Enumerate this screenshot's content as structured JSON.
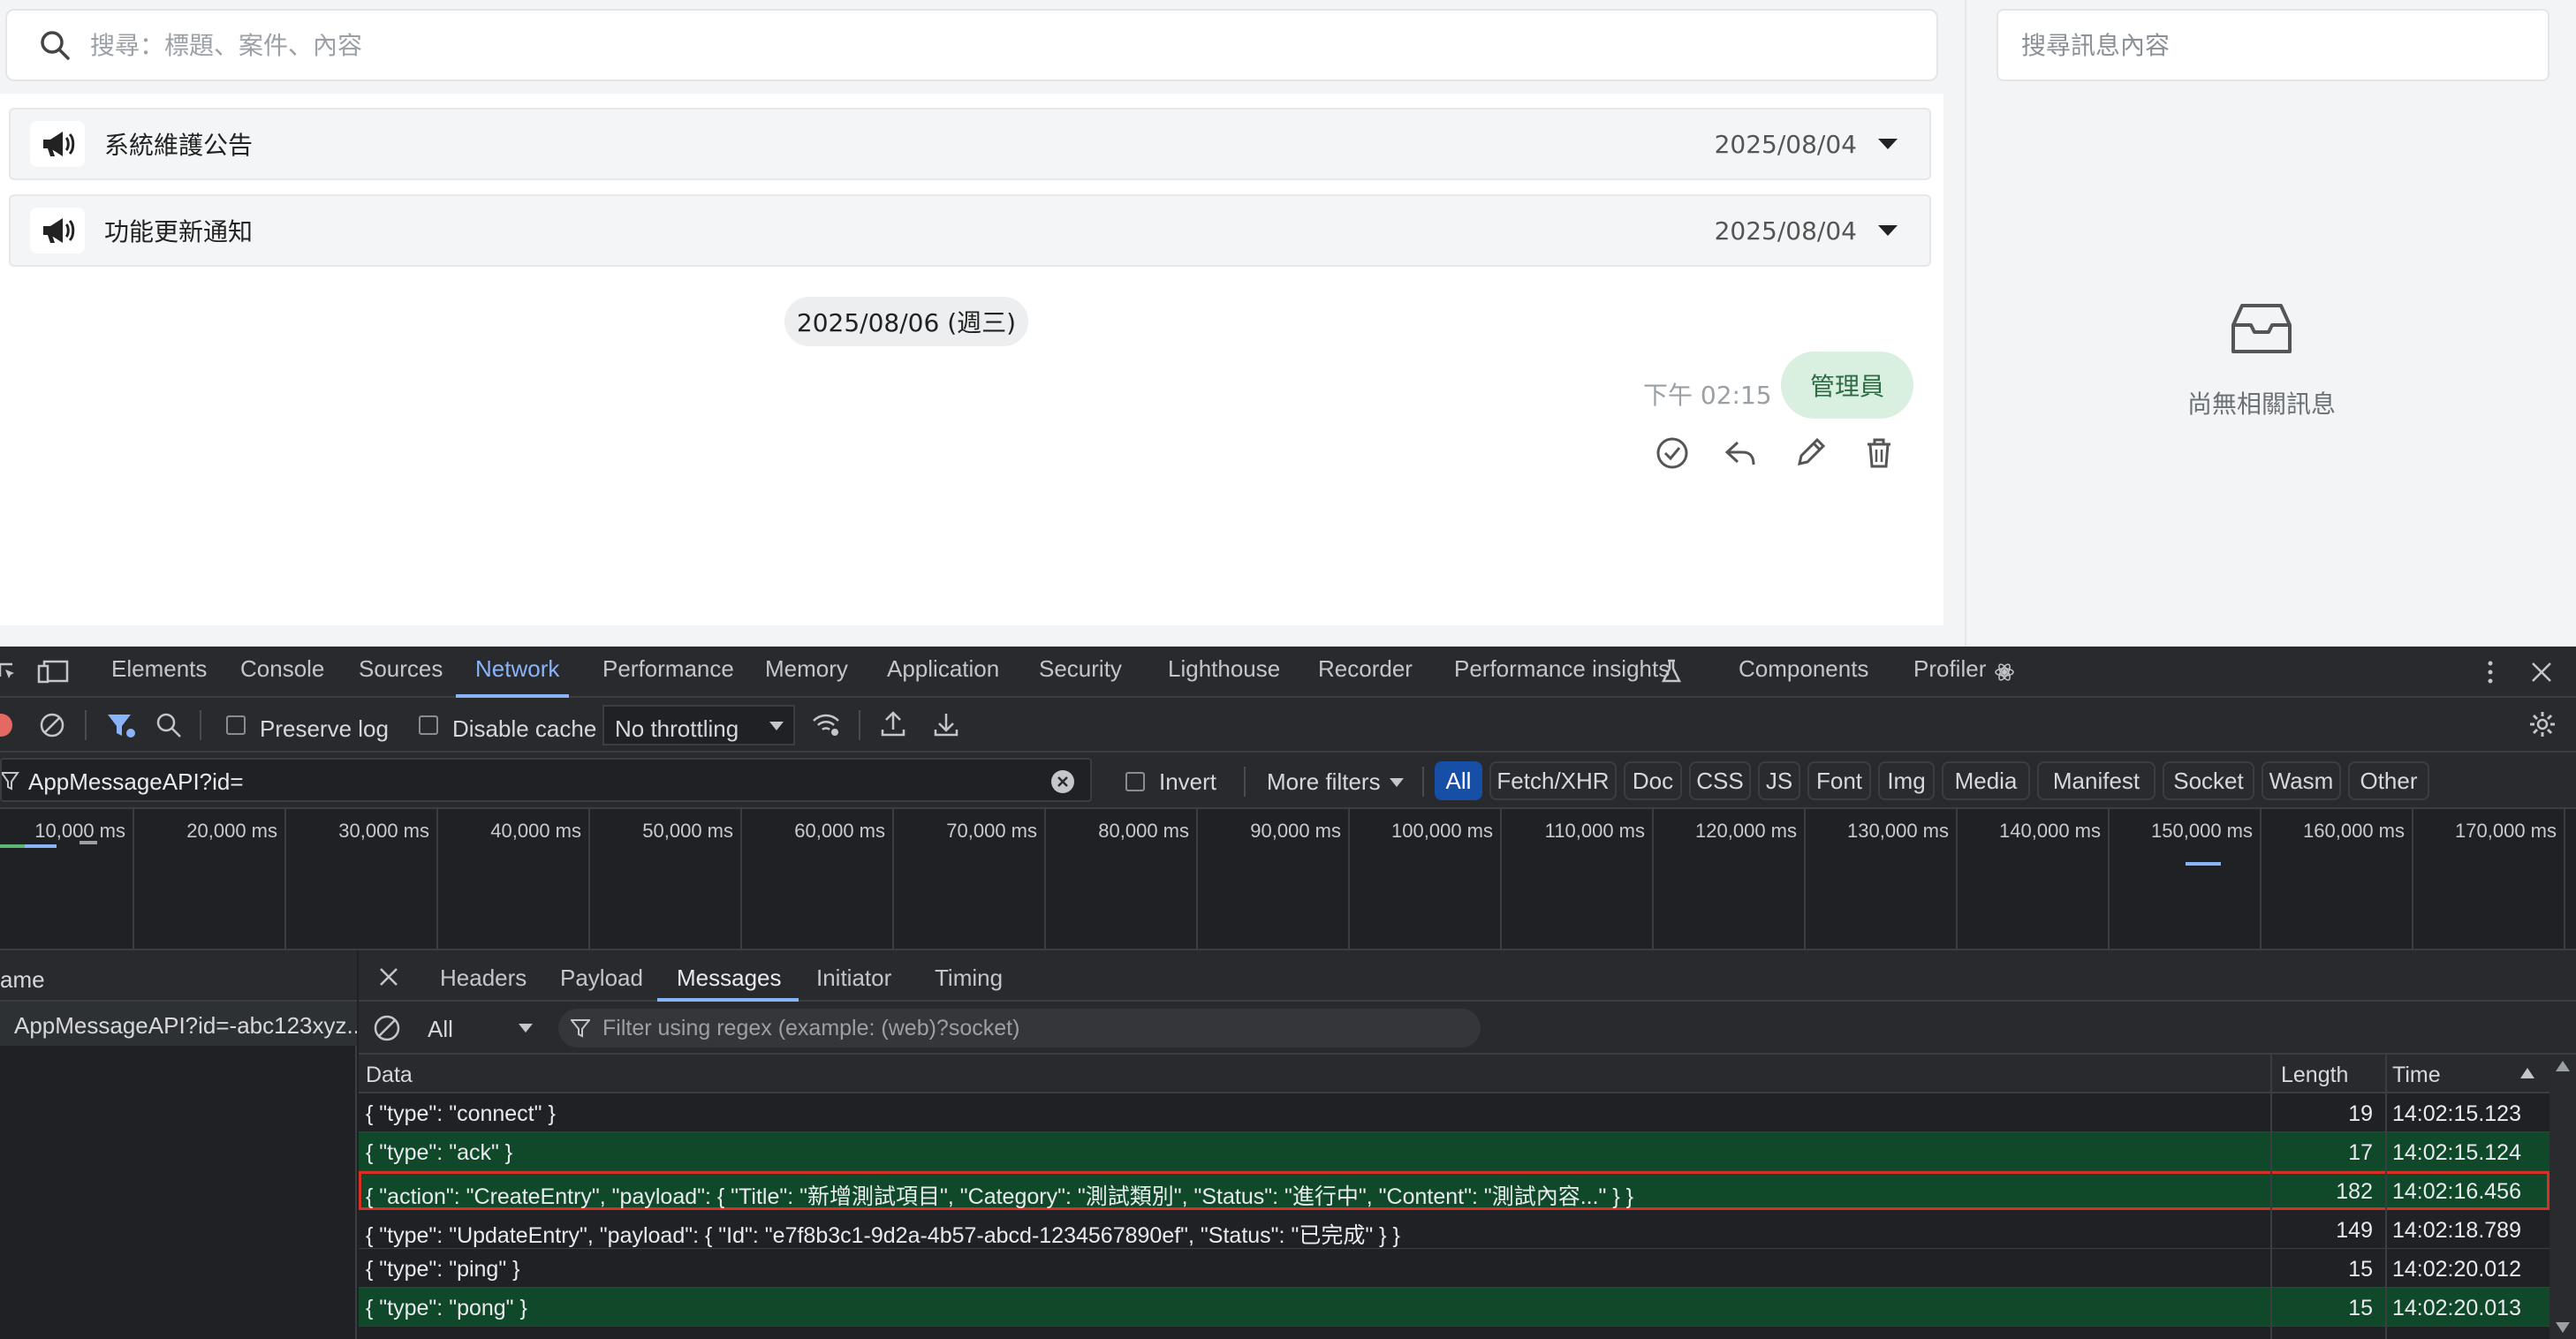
{
  "app": {
    "search_placeholder": "搜尋：標題、案件、內容",
    "announcements": [
      {
        "title": "系統維護公告",
        "date": "2025/08/04"
      },
      {
        "title": "功能更新通知",
        "date": "2025/08/04"
      }
    ],
    "date_divider": "2025/08/06 (週三)",
    "message": {
      "time": "下午 02:15",
      "sender": "管理員"
    },
    "message_actions": [
      "check-circle-icon",
      "reply-icon",
      "edit-icon",
      "trash-icon"
    ],
    "right_panel": {
      "search_placeholder": "搜尋訊息內容",
      "empty_text": "尚無相關訊息"
    }
  },
  "devtools": {
    "tabs": [
      "Elements",
      "Console",
      "Sources",
      "Network",
      "Performance",
      "Memory",
      "Application",
      "Security",
      "Lighthouse",
      "Recorder",
      "Performance insights",
      "Components",
      "Profiler"
    ],
    "active_tab": "Network",
    "toolbar": {
      "preserve_log": "Preserve log",
      "disable_cache": "Disable cache",
      "throttling": "No throttling"
    },
    "filter": {
      "value": "AppMessageAPI?id=",
      "invert": "Invert",
      "more_filters": "More filters",
      "types": [
        "All",
        "Fetch/XHR",
        "Doc",
        "CSS",
        "JS",
        "Font",
        "Img",
        "Media",
        "Manifest",
        "Socket",
        "Wasm",
        "Other"
      ],
      "active_type": "All"
    },
    "timeline_ticks": [
      "10,000 ms",
      "20,000 ms",
      "30,000 ms",
      "40,000 ms",
      "50,000 ms",
      "60,000 ms",
      "70,000 ms",
      "80,000 ms",
      "90,000 ms",
      "100,000 ms",
      "110,000 ms",
      "120,000 ms",
      "130,000 ms",
      "140,000 ms",
      "150,000 ms",
      "160,000 ms",
      "170,000 ms"
    ],
    "name_column": {
      "header": "ame",
      "request": "AppMessageAPI?id=-abc123xyz..."
    },
    "detail_tabs": [
      "Headers",
      "Payload",
      "Messages",
      "Initiator",
      "Timing"
    ],
    "active_detail_tab": "Messages",
    "messages_filter": {
      "type": "All",
      "regex_placeholder": "Filter using regex (example: (web)?socket)"
    },
    "table": {
      "headers": {
        "data": "Data",
        "length": "Length",
        "time": "Time"
      },
      "rows": [
        {
          "data": "{  \"type\": \"connect\" }",
          "length": "19",
          "time": "14:02:15.123",
          "style": "dark"
        },
        {
          "data": "{  \"type\": \"ack\" }",
          "length": "17",
          "time": "14:02:15.124",
          "style": "green"
        },
        {
          "data": "{  \"action\": \"CreateEntry\", \"payload\": { \"Title\": \"新增測試項目\", \"Category\": \"測試類別\", \"Status\": \"進行中\", \"Content\": \"測試內容...\" } }",
          "length": "182",
          "time": "14:02:16.456",
          "style": "green",
          "highlighted": true
        },
        {
          "data": "{  \"type\": \"UpdateEntry\", \"payload\": { \"Id\": \"e7f8b3c1-9d2a-4b57-abcd-1234567890ef\", \"Status\": \"已完成\" } }",
          "length": "149",
          "time": "14:02:18.789",
          "style": "dark"
        },
        {
          "data": "{  \"type\": \"ping\" }",
          "length": "15",
          "time": "14:02:20.012",
          "style": "dark"
        },
        {
          "data": "{  \"type\": \"pong\" }",
          "length": "15",
          "time": "14:02:20.013",
          "style": "green"
        }
      ]
    }
  },
  "colors": {
    "accent": "#8ab4f8",
    "active_pill": "#174ea6",
    "green_row": "#10492a",
    "highlight_border": "#d93025",
    "bubble_bg": "#d9efe0",
    "bubble_text": "#2d6b45"
  }
}
